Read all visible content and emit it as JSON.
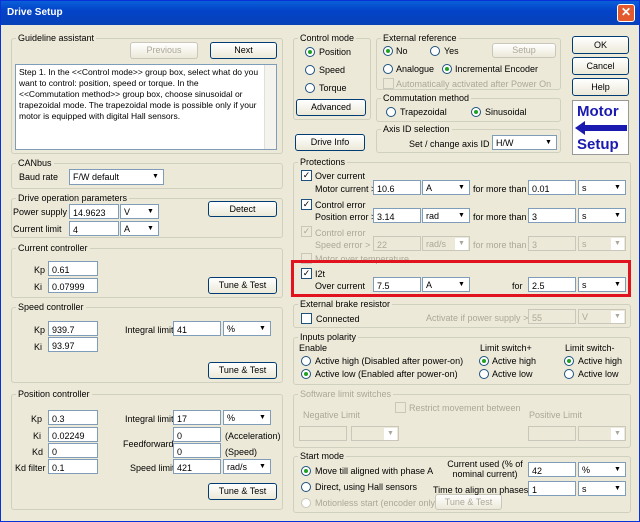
{
  "title": "Drive Setup",
  "guideline": {
    "label": "Guideline assistant",
    "prev": "Previous",
    "next": "Next",
    "text": "Step 1.    In the <<Control mode>> group box, select what do you want to control: position, speed or torque.   In the <<Commutation method>> group box, choose sinusoidal or trapezoidal mode. The trapezoidal mode is possible only if your motor is equipped with digital Hall sensors."
  },
  "canbus": {
    "label": "CANbus",
    "baud_label": "Baud rate",
    "baud_value": "F/W default"
  },
  "drive_params": {
    "label": "Drive operation parameters",
    "power_label": "Power supply",
    "power_value": "14.9623",
    "power_unit": "V",
    "current_label": "Current limit",
    "current_value": "4",
    "current_unit": "A",
    "detect": "Detect"
  },
  "current_ctrl": {
    "label": "Current controller",
    "kp_label": "Kp",
    "kp": "0.61",
    "ki_label": "Ki",
    "ki": "0.07999",
    "tune": "Tune & Test"
  },
  "speed_ctrl": {
    "label": "Speed controller",
    "kp_label": "Kp",
    "kp": "939.7",
    "ki_label": "Ki",
    "ki": "93.97",
    "intlim_label": "Integral limit",
    "intlim": "41",
    "intlim_unit": "%",
    "tune": "Tune & Test"
  },
  "pos_ctrl": {
    "label": "Position controller",
    "kp_label": "Kp",
    "kp": "0.3",
    "ki_label": "Ki",
    "ki": "0.02249",
    "kd_label": "Kd",
    "kd": "0",
    "kdf_label": "Kd filter",
    "kdf": "0.1",
    "intlim_label": "Integral limit",
    "intlim": "17",
    "intlim_unit": "%",
    "ff_label": "Feedforward",
    "ff_acc": "0",
    "ff_acc_label": "(Acceleration)",
    "ff_spd": "0",
    "ff_spd_label": "(Speed)",
    "spdlim_label": "Speed limit",
    "spdlim": "421",
    "spdlim_unit": "rad/s",
    "tune": "Tune & Test"
  },
  "control_mode": {
    "label": "Control mode",
    "options": [
      "Position",
      "Speed",
      "Torque"
    ],
    "advanced": "Advanced"
  },
  "ext_ref": {
    "label": "External reference",
    "no": "No",
    "yes": "Yes",
    "setup": "Setup",
    "analogue": "Analogue",
    "encoder": "Incremental Encoder",
    "auto": "Automatically activated after Power On"
  },
  "commutation": {
    "label": "Commutation method",
    "trap": "Trapezoidal",
    "sin": "Sinusoidal"
  },
  "drive_info": "Drive Info",
  "axis": {
    "label": "Axis ID selection",
    "set_label": "Set / change axis ID",
    "value": "H/W"
  },
  "buttons": {
    "ok": "OK",
    "cancel": "Cancel",
    "help": "Help"
  },
  "logo": {
    "line1": "Motor",
    "line2": "Setup"
  },
  "protections": {
    "label": "Protections",
    "oc_label": "Over current",
    "oc_cur_label": "Motor current >",
    "oc_cur": "10.6",
    "oc_unit": "A",
    "oc_for": "for more than",
    "oc_time": "0.01",
    "oc_tunit": "s",
    "ce_label": "Control error",
    "ce_pos_label": "Position error >",
    "ce_pos": "3.14",
    "ce_unit": "rad",
    "ce_for": "for more than",
    "ce_time": "3",
    "ce_tunit": "s",
    "ce2_label": "Control error",
    "ce2_spd_label": "Speed error >",
    "ce2_spd": "22",
    "ce2_unit": "rad/s",
    "ce2_for": "for more than",
    "ce2_time": "3",
    "ce2_tunit": "s",
    "mt_label": "Motor over temperature",
    "i2t_label": "I2t",
    "i2t_oc_label": "Over current",
    "i2t_val": "7.5",
    "i2t_unit": "A",
    "i2t_for": "for",
    "i2t_time": "2.5",
    "i2t_tunit": "s"
  },
  "brake": {
    "label": "External brake resistor",
    "connected": "Connected",
    "activate_label": "Activate if power supply >",
    "value": "55",
    "unit": "V"
  },
  "inputs": {
    "label": "Inputs polarity",
    "enable": "Enable",
    "ah": "Active high (Disabled after power-on)",
    "al": "Active low (Enabled after power-on)",
    "lplus": "Limit switch+",
    "lminus": "Limit switch-",
    "ah_s": "Active high",
    "al_s": "Active low"
  },
  "sw_limits": {
    "label": "Software limit switches",
    "restrict": "Restrict movement between",
    "neg": "Negative Limit",
    "pos": "Positive Limit"
  },
  "start": {
    "label": "Start mode",
    "opt1": "Move till aligned with phase A",
    "opt2": "Direct, using Hall sensors",
    "opt3": "Motionless start (encoder only)",
    "tune": "Tune & Test",
    "cur_label": "Current used (% of nominal current)",
    "cur_val": "42",
    "cur_unit": "%",
    "time_label": "Time to align on phases",
    "time_val": "1",
    "time_unit": "s"
  },
  "colors": {
    "title_bar": "#0343c8",
    "highlight": "#e0131e",
    "logo": "#1a1ab0"
  }
}
